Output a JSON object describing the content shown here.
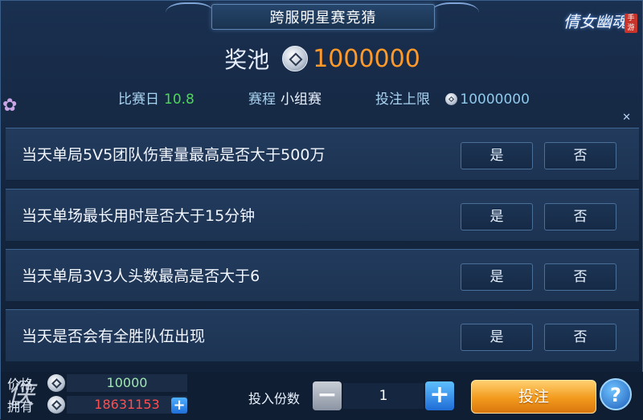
{
  "header": {
    "title": "跨服明星赛竞猜",
    "logo_text": "倩女幽魂",
    "logo_stamp": "手游"
  },
  "pool": {
    "label": "奖池",
    "value": "1000000"
  },
  "info": {
    "day_label": "比赛日",
    "day_value": "10.8",
    "schedule_label": "赛程",
    "schedule_value": "小组赛",
    "limit_label": "投注上限",
    "limit_value": "10000000"
  },
  "questions": [
    {
      "text": "当天单局5V5团队伤害量最高是否大于500万",
      "yes": "是",
      "no": "否"
    },
    {
      "text": "当天单场最长用时是否大于15分钟",
      "yes": "是",
      "no": "否"
    },
    {
      "text": "当天单局3V3人头数最高是否大于6",
      "yes": "是",
      "no": "否"
    },
    {
      "text": "当天是否会有全胜队伍出现",
      "yes": "是",
      "no": "否"
    }
  ],
  "footer": {
    "price_label": "价格",
    "price_value": "10000",
    "own_label": "拥有",
    "own_value": "18631153",
    "qty_label": "投入份数",
    "qty_value": "1",
    "bet_label": "投注",
    "help_label": "?",
    "plus_label": "+",
    "minus_label": "−"
  },
  "colors": {
    "pool_value": "#ff9a2a",
    "day_value": "#4fd65a",
    "own_value": "#ff4e4e",
    "bet_button": "#f29a1c"
  },
  "icons": [
    "coin-icon",
    "plus-icon",
    "minus-icon",
    "help-icon",
    "close-icon",
    "flower-decoration"
  ]
}
